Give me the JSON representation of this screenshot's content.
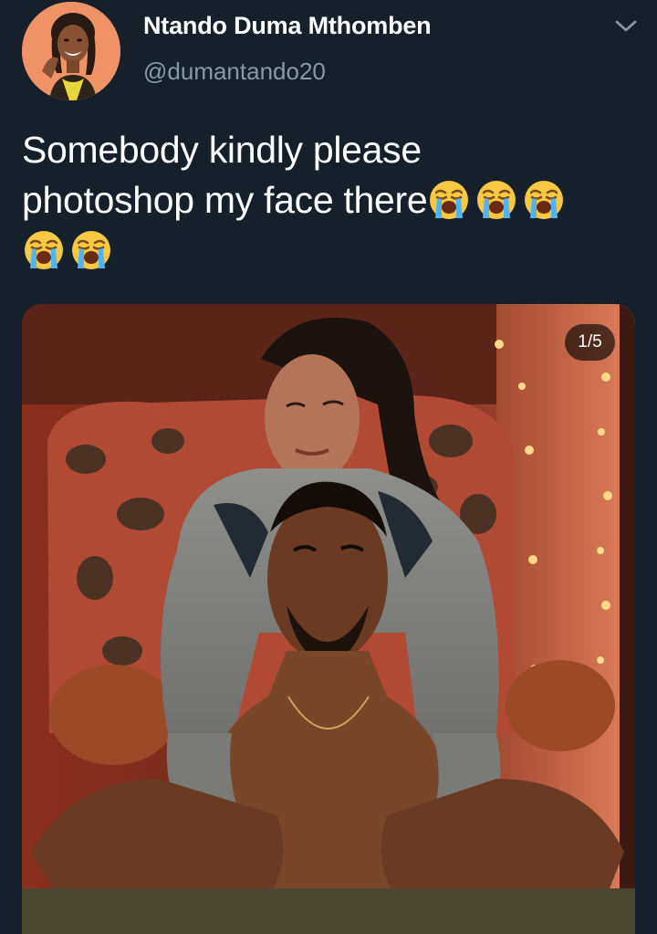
{
  "tweet": {
    "author": {
      "display_name": "Ntando Duma Mthomben",
      "handle": "@dumantando20",
      "avatar_icon": "profile-photo"
    },
    "text_line_1": "Somebody kindly please",
    "text_line_2": "photoshop my face there",
    "emoji": "loudly-crying-face",
    "emoji_count": 5,
    "more_icon": "chevron-down-icon",
    "media": {
      "counter": "1/5",
      "description_icon": "photo"
    }
  },
  "colors": {
    "background": "#15202b",
    "text": "#ffffff",
    "secondary_text": "#8899a6"
  }
}
